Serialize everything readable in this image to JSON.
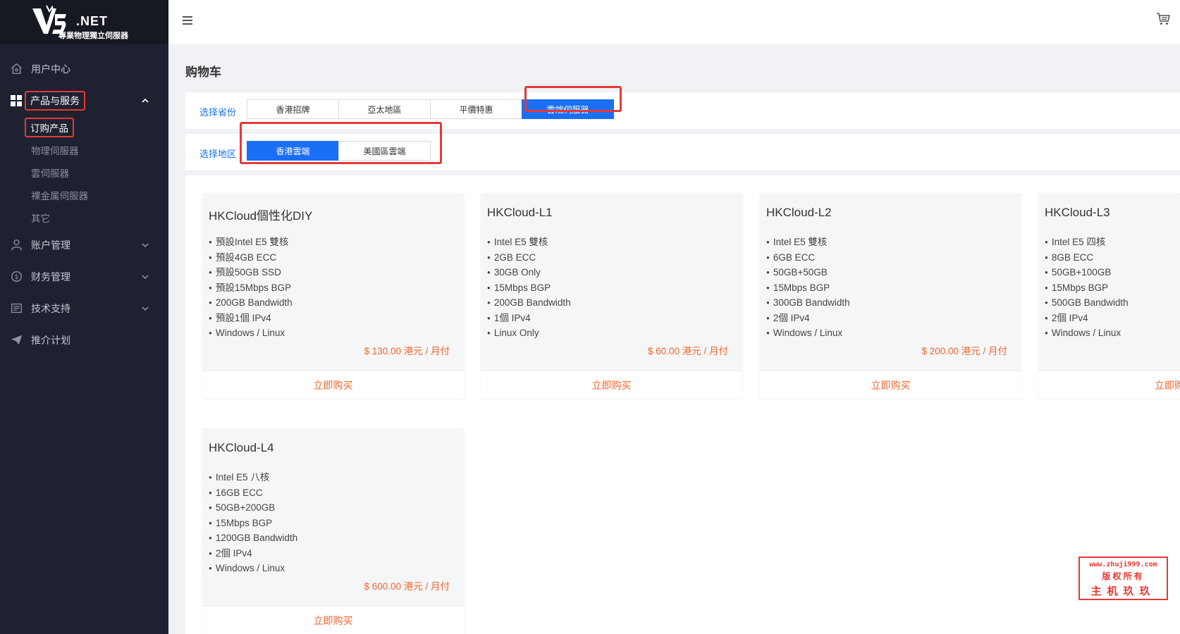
{
  "brand": {
    "logo_text": ".NET",
    "tagline": "專業物理獨立伺服器"
  },
  "sidebar": {
    "items": [
      {
        "label": "用户中心",
        "icon": "home-icon"
      },
      {
        "label": "产品与服务",
        "icon": "grid-icon",
        "expanded": true,
        "children": [
          "订购产品",
          "物理伺服器",
          "雲伺服器",
          "裸金属伺服器",
          "其它"
        ]
      },
      {
        "label": "账户管理",
        "icon": "user-icon"
      },
      {
        "label": "财务管理",
        "icon": "dollar-icon"
      },
      {
        "label": "技术支持",
        "icon": "ticket-icon"
      },
      {
        "label": "推介计划",
        "icon": "send-icon"
      }
    ]
  },
  "header": {
    "menu_icon": "hamburger-icon",
    "cart_icon": "cart-icon"
  },
  "page": {
    "title": "购物车"
  },
  "filters": {
    "province": {
      "label": "选择省份",
      "options": [
        "香港招牌",
        "亞太地區",
        "平價特惠",
        "雲端伺服器"
      ],
      "selected": "雲端伺服器"
    },
    "region": {
      "label": "选择地区",
      "options": [
        "香港雲端",
        "美國區雲端"
      ],
      "selected": "香港雲端"
    }
  },
  "products": [
    {
      "name": "HKCloud個性化DIY",
      "features": [
        "預設Intel E5 雙核",
        "預設4GB ECC",
        "預設50GB SSD",
        "預設15Mbps BGP",
        "200GB Bandwidth",
        "預設1個 IPv4",
        "Windows / Linux"
      ],
      "price": "$ 130.00 港元 / 月付",
      "button": "立即购买"
    },
    {
      "name": "HKCloud-L1",
      "features": [
        "Intel E5 雙核",
        "2GB ECC",
        "30GB Only",
        "15Mbps BGP",
        "200GB Bandwidth",
        "1個 IPv4",
        "Linux Only"
      ],
      "price": "$ 60.00 港元 / 月付",
      "button": "立即购买"
    },
    {
      "name": "HKCloud-L2",
      "features": [
        "Intel E5 雙核",
        "6GB ECC",
        "50GB+50GB",
        "15Mbps BGP",
        "300GB Bandwidth",
        "2個 IPv4",
        "Windows / Linux"
      ],
      "price": "$ 200.00 港元 / 月付",
      "button": "立即购买"
    },
    {
      "name": "HKCloud-L3",
      "features": [
        "Intel E5 四核",
        "8GB ECC",
        "50GB+100GB",
        "15Mbps BGP",
        "500GB Bandwidth",
        "2個 IPv4",
        "Windows / Linux"
      ],
      "price": "",
      "button": "立即购买"
    },
    {
      "name": "HKCloud-L4",
      "features": [
        "Intel E5 八核",
        "16GB ECC",
        "50GB+200GB",
        "15Mbps BGP",
        "1200GB Bandwidth",
        "2個 IPv4",
        "Windows / Linux"
      ],
      "price": "$ 600.00 港元 / 月付",
      "button": "立即购买"
    }
  ],
  "watermark": {
    "line1": "www.zhuji999.com",
    "line2": "版权所有",
    "line3": "主机玖玖"
  },
  "colors": {
    "sidebar_bg": "#1e2130",
    "accent": "#1a6ff5",
    "price": "#f0652a",
    "highlight": "#e53935"
  }
}
